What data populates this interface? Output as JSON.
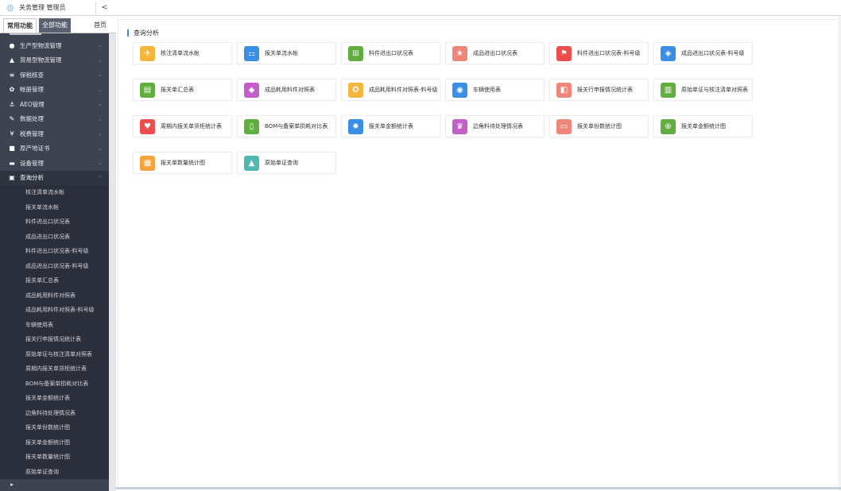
{
  "header": {
    "title": "关务管理 管理员",
    "collapse_glyph": "<"
  },
  "sidebar": {
    "tabs": [
      {
        "label": "常用功能"
      },
      {
        "label": "全部功能"
      },
      {
        "label": "首页"
      }
    ],
    "menu": [
      {
        "label": "生产型物流管理",
        "icon": "circle-icon",
        "glyph": "●"
      },
      {
        "label": "贸易型物流管理",
        "icon": "cart-icon",
        "glyph": "▲"
      },
      {
        "label": "保税核查",
        "icon": "layers-icon",
        "glyph": "≡"
      },
      {
        "label": "帐册管理",
        "icon": "gear-icon",
        "glyph": "✿"
      },
      {
        "label": "AEO管理",
        "icon": "anchor-icon",
        "glyph": "⚓"
      },
      {
        "label": "数据处理",
        "icon": "edit-icon",
        "glyph": "✎"
      },
      {
        "label": "税费管理",
        "icon": "cart2-icon",
        "glyph": "¥"
      },
      {
        "label": "原产地证书",
        "icon": "bookmark-icon",
        "glyph": "■"
      },
      {
        "label": "设备管理",
        "icon": "device-icon",
        "glyph": "▬"
      },
      {
        "label": "查询分析",
        "icon": "query-icon",
        "glyph": "▣"
      }
    ],
    "submenu": [
      "核注清单流水帐",
      "报关单流水帐",
      "料件进出口状况表",
      "成品进出口状况表",
      "料件进出口状况表-料号级",
      "成品进出口状况表-料号级",
      "报关单汇总表",
      "成品耗用料件对照表",
      "成品耗用料件对照表-料号级",
      "车辆使用表",
      "报关行申报情况统计表",
      "原始单证与核注清单对照表",
      "周期内报关单货柜统计表",
      "BOM与备案单损耗对比表",
      "报关单金额统计表",
      "边角料待处理情况表",
      "报关单份数统计图",
      "报关单金额统计图",
      "报关单数量统计图",
      "原始单证查询"
    ]
  },
  "main": {
    "section_title": "查询分析",
    "cards": [
      {
        "label": "核注清单流水帐",
        "color": "#f5b63b",
        "icon": "plane-icon",
        "glyph": "✈"
      },
      {
        "label": "报关单流水帐",
        "color": "#3a8ee6",
        "icon": "grid-icon",
        "glyph": "⚏"
      },
      {
        "label": "料件进出口状况表",
        "color": "#5fae3e",
        "icon": "apps-icon",
        "glyph": "⊞"
      },
      {
        "label": "成品进出口状况表",
        "color": "#f0867a",
        "icon": "star-icon",
        "glyph": "★"
      },
      {
        "label": "料件进出口状况表-料号级",
        "color": "#ec4d4d",
        "icon": "flag-icon",
        "glyph": "⚑"
      },
      {
        "label": "成品进出口状况表-料号级",
        "color": "#3a8ee6",
        "icon": "stack-icon",
        "glyph": "◈"
      },
      {
        "label": "报关单汇总表",
        "color": "#5fae3e",
        "icon": "document-icon",
        "glyph": "▤"
      },
      {
        "label": "成品耗用料件对照表",
        "color": "#c55ec8",
        "icon": "tag-icon",
        "glyph": "◆"
      },
      {
        "label": "成品耗用料件对照表-料号级",
        "color": "#f5b63b",
        "icon": "award-icon",
        "glyph": "✪"
      },
      {
        "label": "车辆使用表",
        "color": "#3a8ee6",
        "icon": "compass-icon",
        "glyph": "◉"
      },
      {
        "label": "报关行申报情况统计表",
        "color": "#f0867a",
        "icon": "box-icon",
        "glyph": "◧"
      },
      {
        "label": "原始单证与核注清单对照表",
        "color": "#5fae3e",
        "icon": "notebook-icon",
        "glyph": "▥"
      },
      {
        "label": "周期内报关单货柜统计表",
        "color": "#ec4d4d",
        "icon": "heart-icon",
        "glyph": "♥"
      },
      {
        "label": "BOM与备案单损耗对比表",
        "color": "#5fae3e",
        "icon": "book-icon",
        "glyph": "▯"
      },
      {
        "label": "报关单金额统计表",
        "color": "#3a8ee6",
        "icon": "settings-icon",
        "glyph": "✹"
      },
      {
        "label": "边角料待处理情况表",
        "color": "#c55ec8",
        "icon": "crown-icon",
        "glyph": "♛"
      },
      {
        "label": "报关单份数统计图",
        "color": "#f0867a",
        "icon": "monitor-icon",
        "glyph": "▭"
      },
      {
        "label": "报关单金额统计图",
        "color": "#5fae3e",
        "icon": "globe-icon",
        "glyph": "⊕"
      },
      {
        "label": "报关单数量统计图",
        "color": "#f5a33b",
        "icon": "image-icon",
        "glyph": "▦"
      },
      {
        "label": "原始单证查询",
        "color": "#4fb8b0",
        "icon": "triangles-icon",
        "glyph": "▲"
      }
    ]
  }
}
